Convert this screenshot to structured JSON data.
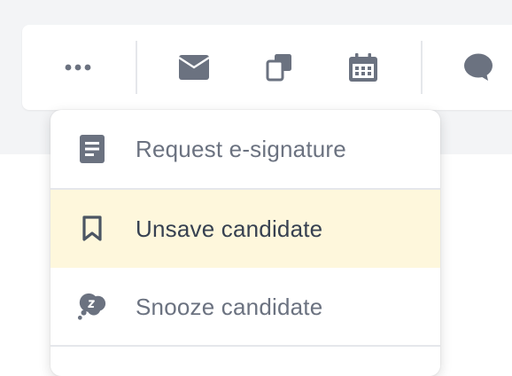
{
  "toolbar": {
    "buttons": [
      {
        "name": "more-options",
        "icon": "ellipsis-icon"
      },
      {
        "name": "email",
        "icon": "envelope-icon"
      },
      {
        "name": "copy",
        "icon": "copy-icon"
      },
      {
        "name": "schedule",
        "icon": "calendar-icon"
      },
      {
        "name": "comment",
        "icon": "comment-icon"
      }
    ]
  },
  "menu": {
    "items": [
      {
        "label": "Request e-signature",
        "icon": "document-icon"
      },
      {
        "label": "Unsave candidate",
        "icon": "bookmark-icon",
        "highlighted": true
      },
      {
        "label": "Snooze candidate",
        "icon": "snooze-icon"
      }
    ]
  },
  "colors": {
    "icon": "#6b7280",
    "highlight": "#fef7dc",
    "text_active": "#374151",
    "text": "#6b7280",
    "background_band": "#f3f4f6"
  }
}
